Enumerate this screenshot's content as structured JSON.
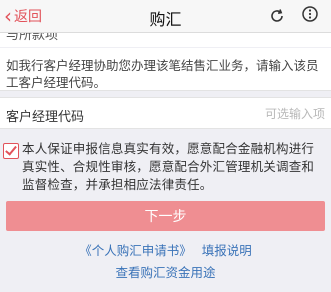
{
  "nav": {
    "back_label": "返回",
    "title": "购汇",
    "refresh_icon": "refresh-icon",
    "more_icon": "more-icon"
  },
  "form": {
    "cut_row_label": "与所款项",
    "info_text": "如我行客户经理协助您办理该笔结售汇业务，请输入该员工客户经理代码。",
    "manager_code_label": "客户经理代码",
    "manager_code_placeholder": "可选输入项",
    "manager_code_value": ""
  },
  "declaration": {
    "checked": true,
    "text": "本人保证申报信息真实有效，愿意配合金融机构进行真实性、合规性审核，愿意配合外汇管理机关调查和监督检查，并承担相应法律责任。"
  },
  "actions": {
    "next_label": "下一步",
    "application_link": "《个人购汇申请书》",
    "fill_guide_link": "填报说明",
    "fund_use_link": "查看购汇资金用途"
  },
  "colors": {
    "accent": "#e2525a",
    "button_disabled": "#ef8e92",
    "link": "#3a73b8",
    "background": "#efeff4"
  }
}
